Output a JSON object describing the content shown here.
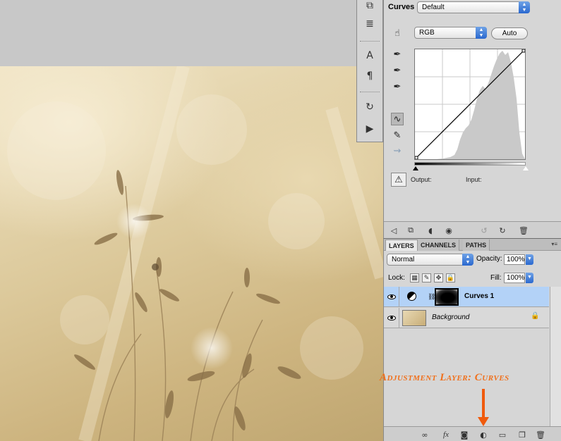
{
  "adjustments": {
    "title": "Curves",
    "preset": "Default",
    "channel": "RGB",
    "auto_label": "Auto",
    "output_label": "Output:",
    "input_label": "Input:"
  },
  "layers_panel": {
    "tabs": [
      {
        "label": "LAYERS",
        "active": true
      },
      {
        "label": "CHANNELS",
        "active": false
      },
      {
        "label": "PATHS",
        "active": false
      }
    ],
    "blend_mode": "Normal",
    "opacity_label": "Opacity:",
    "opacity_value": "100%",
    "lock_label": "Lock:",
    "fill_label": "Fill:",
    "fill_value": "100%",
    "layers": [
      {
        "name": "Curves 1",
        "selected": true,
        "type": "adjustment"
      },
      {
        "name": "Background",
        "selected": false,
        "type": "image",
        "locked": true
      }
    ]
  },
  "annotation": {
    "text": "Adjustment Layer: Curves",
    "color": "#f0701c"
  },
  "icons": {
    "tool_strip": [
      "layer-comps-icon",
      "tool-presets-icon",
      "character-icon",
      "paragraph-icon",
      "history-icon",
      "actions-icon"
    ],
    "curve_tools": [
      "target-adjust-icon",
      "black-eyedropper-icon",
      "gray-eyedropper-icon",
      "white-eyedropper-icon",
      "curve-point-icon",
      "pencil-icon",
      "smooth-icon",
      "clipping-warning-icon"
    ],
    "adj_footer": [
      "back-arrow-icon",
      "expand-view-icon",
      "clip-layer-icon",
      "visibility-icon",
      "previous-state-icon",
      "reset-icon",
      "trash-icon"
    ],
    "layers_footer": [
      "link-icon",
      "fx-icon",
      "mask-icon",
      "new-adjustment-icon",
      "new-group-icon",
      "new-layer-icon",
      "trash-icon"
    ]
  },
  "colors": {
    "selection_blue": "#b3d2f7",
    "accent_blue": "#2a68cf",
    "annotation_orange": "#f05a0c"
  }
}
